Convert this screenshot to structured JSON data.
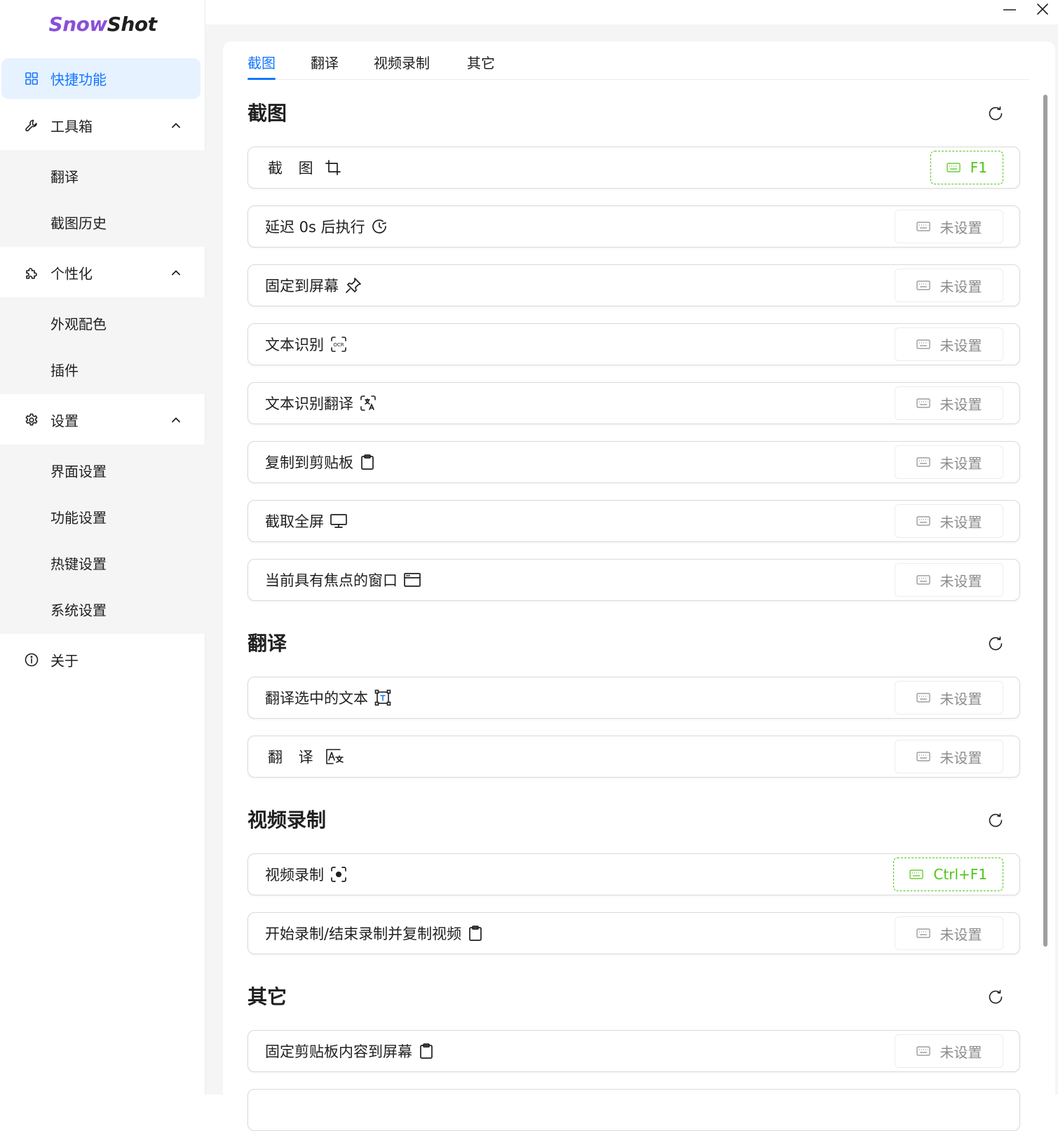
{
  "app": {
    "logo_part1": "Snow",
    "logo_part2": "Shot"
  },
  "sidebar": {
    "active": {
      "label": "快捷功能",
      "icon": "grid-icon"
    },
    "groups": [
      {
        "label": "工具箱",
        "icon": "wrench-icon",
        "children": [
          "翻译",
          "截图历史"
        ]
      },
      {
        "label": "个性化",
        "icon": "puzzle-icon",
        "children": [
          "外观配色",
          "插件"
        ]
      },
      {
        "label": "设置",
        "icon": "gear-icon",
        "children": [
          "界面设置",
          "功能设置",
          "热键设置",
          "系统设置"
        ]
      }
    ],
    "about": {
      "label": "关于",
      "icon": "info-icon"
    }
  },
  "tabs": [
    "截图",
    "翻译",
    "视频录制",
    "其它"
  ],
  "unset_label": "未设置",
  "sections": {
    "screenshot": {
      "title": "截图",
      "rows": [
        {
          "label": "截 图",
          "icon": "crop-icon",
          "hotkey": "F1"
        },
        {
          "label": "延迟 0s 后执行",
          "icon": "clock-icon"
        },
        {
          "label": "固定到屏幕",
          "icon": "pin-icon"
        },
        {
          "label": "文本识别",
          "icon": "ocr-icon"
        },
        {
          "label": "文本识别翻译",
          "icon": "ocr-translate-icon"
        },
        {
          "label": "复制到剪贴板",
          "icon": "clipboard-icon"
        },
        {
          "label": "截取全屏",
          "icon": "monitor-icon"
        },
        {
          "label": "当前具有焦点的窗口",
          "icon": "window-icon"
        }
      ]
    },
    "translate": {
      "title": "翻译",
      "rows": [
        {
          "label": "翻译选中的文本",
          "icon": "text-select-icon"
        },
        {
          "label": "翻 译",
          "icon": "translate-icon"
        }
      ]
    },
    "video": {
      "title": "视频录制",
      "rows": [
        {
          "label": "视频录制",
          "icon": "record-icon",
          "hotkey": "Ctrl+F1"
        },
        {
          "label": "开始录制/结束录制并复制视频",
          "icon": "clipboard-icon"
        }
      ]
    },
    "other": {
      "title": "其它",
      "rows": [
        {
          "label": "固定剪贴板内容到屏幕",
          "icon": "clipboard-icon"
        }
      ]
    }
  },
  "colors": {
    "accent": "#1677ff",
    "accent_bg": "#e6f2ff",
    "hotkey_set": "#52c41a",
    "logo_purple": "#8a4fd8"
  }
}
